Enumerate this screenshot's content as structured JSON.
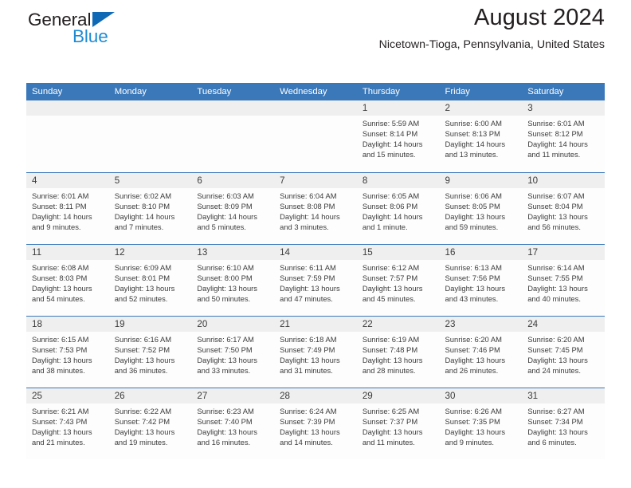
{
  "brand": {
    "name_dark": "General",
    "name_blue": "Blue",
    "triangle_color": "#1069b4",
    "blue_color": "#1e8bd4"
  },
  "header": {
    "title": "August 2024",
    "subtitle": "Nicetown-Tioga, Pennsylvania, United States",
    "header_bg": "#3a78ba",
    "header_text": "#ffffff"
  },
  "calendar": {
    "weekday_headers": [
      "Sunday",
      "Monday",
      "Tuesday",
      "Wednesday",
      "Thursday",
      "Friday",
      "Saturday"
    ],
    "weeks": [
      [
        {
          "day": "",
          "sunrise": "",
          "sunset": "",
          "daylight_line1": "",
          "daylight_line2": "",
          "empty": true
        },
        {
          "day": "",
          "sunrise": "",
          "sunset": "",
          "daylight_line1": "",
          "daylight_line2": "",
          "empty": true
        },
        {
          "day": "",
          "sunrise": "",
          "sunset": "",
          "daylight_line1": "",
          "daylight_line2": "",
          "empty": true
        },
        {
          "day": "",
          "sunrise": "",
          "sunset": "",
          "daylight_line1": "",
          "daylight_line2": "",
          "empty": true
        },
        {
          "day": "1",
          "sunrise": "Sunrise: 5:59 AM",
          "sunset": "Sunset: 8:14 PM",
          "daylight_line1": "Daylight: 14 hours",
          "daylight_line2": "and 15 minutes.",
          "empty": false
        },
        {
          "day": "2",
          "sunrise": "Sunrise: 6:00 AM",
          "sunset": "Sunset: 8:13 PM",
          "daylight_line1": "Daylight: 14 hours",
          "daylight_line2": "and 13 minutes.",
          "empty": false
        },
        {
          "day": "3",
          "sunrise": "Sunrise: 6:01 AM",
          "sunset": "Sunset: 8:12 PM",
          "daylight_line1": "Daylight: 14 hours",
          "daylight_line2": "and 11 minutes.",
          "empty": false
        }
      ],
      [
        {
          "day": "4",
          "sunrise": "Sunrise: 6:01 AM",
          "sunset": "Sunset: 8:11 PM",
          "daylight_line1": "Daylight: 14 hours",
          "daylight_line2": "and 9 minutes.",
          "empty": false
        },
        {
          "day": "5",
          "sunrise": "Sunrise: 6:02 AM",
          "sunset": "Sunset: 8:10 PM",
          "daylight_line1": "Daylight: 14 hours",
          "daylight_line2": "and 7 minutes.",
          "empty": false
        },
        {
          "day": "6",
          "sunrise": "Sunrise: 6:03 AM",
          "sunset": "Sunset: 8:09 PM",
          "daylight_line1": "Daylight: 14 hours",
          "daylight_line2": "and 5 minutes.",
          "empty": false
        },
        {
          "day": "7",
          "sunrise": "Sunrise: 6:04 AM",
          "sunset": "Sunset: 8:08 PM",
          "daylight_line1": "Daylight: 14 hours",
          "daylight_line2": "and 3 minutes.",
          "empty": false
        },
        {
          "day": "8",
          "sunrise": "Sunrise: 6:05 AM",
          "sunset": "Sunset: 8:06 PM",
          "daylight_line1": "Daylight: 14 hours",
          "daylight_line2": "and 1 minute.",
          "empty": false
        },
        {
          "day": "9",
          "sunrise": "Sunrise: 6:06 AM",
          "sunset": "Sunset: 8:05 PM",
          "daylight_line1": "Daylight: 13 hours",
          "daylight_line2": "and 59 minutes.",
          "empty": false
        },
        {
          "day": "10",
          "sunrise": "Sunrise: 6:07 AM",
          "sunset": "Sunset: 8:04 PM",
          "daylight_line1": "Daylight: 13 hours",
          "daylight_line2": "and 56 minutes.",
          "empty": false
        }
      ],
      [
        {
          "day": "11",
          "sunrise": "Sunrise: 6:08 AM",
          "sunset": "Sunset: 8:03 PM",
          "daylight_line1": "Daylight: 13 hours",
          "daylight_line2": "and 54 minutes.",
          "empty": false
        },
        {
          "day": "12",
          "sunrise": "Sunrise: 6:09 AM",
          "sunset": "Sunset: 8:01 PM",
          "daylight_line1": "Daylight: 13 hours",
          "daylight_line2": "and 52 minutes.",
          "empty": false
        },
        {
          "day": "13",
          "sunrise": "Sunrise: 6:10 AM",
          "sunset": "Sunset: 8:00 PM",
          "daylight_line1": "Daylight: 13 hours",
          "daylight_line2": "and 50 minutes.",
          "empty": false
        },
        {
          "day": "14",
          "sunrise": "Sunrise: 6:11 AM",
          "sunset": "Sunset: 7:59 PM",
          "daylight_line1": "Daylight: 13 hours",
          "daylight_line2": "and 47 minutes.",
          "empty": false
        },
        {
          "day": "15",
          "sunrise": "Sunrise: 6:12 AM",
          "sunset": "Sunset: 7:57 PM",
          "daylight_line1": "Daylight: 13 hours",
          "daylight_line2": "and 45 minutes.",
          "empty": false
        },
        {
          "day": "16",
          "sunrise": "Sunrise: 6:13 AM",
          "sunset": "Sunset: 7:56 PM",
          "daylight_line1": "Daylight: 13 hours",
          "daylight_line2": "and 43 minutes.",
          "empty": false
        },
        {
          "day": "17",
          "sunrise": "Sunrise: 6:14 AM",
          "sunset": "Sunset: 7:55 PM",
          "daylight_line1": "Daylight: 13 hours",
          "daylight_line2": "and 40 minutes.",
          "empty": false
        }
      ],
      [
        {
          "day": "18",
          "sunrise": "Sunrise: 6:15 AM",
          "sunset": "Sunset: 7:53 PM",
          "daylight_line1": "Daylight: 13 hours",
          "daylight_line2": "and 38 minutes.",
          "empty": false
        },
        {
          "day": "19",
          "sunrise": "Sunrise: 6:16 AM",
          "sunset": "Sunset: 7:52 PM",
          "daylight_line1": "Daylight: 13 hours",
          "daylight_line2": "and 36 minutes.",
          "empty": false
        },
        {
          "day": "20",
          "sunrise": "Sunrise: 6:17 AM",
          "sunset": "Sunset: 7:50 PM",
          "daylight_line1": "Daylight: 13 hours",
          "daylight_line2": "and 33 minutes.",
          "empty": false
        },
        {
          "day": "21",
          "sunrise": "Sunrise: 6:18 AM",
          "sunset": "Sunset: 7:49 PM",
          "daylight_line1": "Daylight: 13 hours",
          "daylight_line2": "and 31 minutes.",
          "empty": false
        },
        {
          "day": "22",
          "sunrise": "Sunrise: 6:19 AM",
          "sunset": "Sunset: 7:48 PM",
          "daylight_line1": "Daylight: 13 hours",
          "daylight_line2": "and 28 minutes.",
          "empty": false
        },
        {
          "day": "23",
          "sunrise": "Sunrise: 6:20 AM",
          "sunset": "Sunset: 7:46 PM",
          "daylight_line1": "Daylight: 13 hours",
          "daylight_line2": "and 26 minutes.",
          "empty": false
        },
        {
          "day": "24",
          "sunrise": "Sunrise: 6:20 AM",
          "sunset": "Sunset: 7:45 PM",
          "daylight_line1": "Daylight: 13 hours",
          "daylight_line2": "and 24 minutes.",
          "empty": false
        }
      ],
      [
        {
          "day": "25",
          "sunrise": "Sunrise: 6:21 AM",
          "sunset": "Sunset: 7:43 PM",
          "daylight_line1": "Daylight: 13 hours",
          "daylight_line2": "and 21 minutes.",
          "empty": false
        },
        {
          "day": "26",
          "sunrise": "Sunrise: 6:22 AM",
          "sunset": "Sunset: 7:42 PM",
          "daylight_line1": "Daylight: 13 hours",
          "daylight_line2": "and 19 minutes.",
          "empty": false
        },
        {
          "day": "27",
          "sunrise": "Sunrise: 6:23 AM",
          "sunset": "Sunset: 7:40 PM",
          "daylight_line1": "Daylight: 13 hours",
          "daylight_line2": "and 16 minutes.",
          "empty": false
        },
        {
          "day": "28",
          "sunrise": "Sunrise: 6:24 AM",
          "sunset": "Sunset: 7:39 PM",
          "daylight_line1": "Daylight: 13 hours",
          "daylight_line2": "and 14 minutes.",
          "empty": false
        },
        {
          "day": "29",
          "sunrise": "Sunrise: 6:25 AM",
          "sunset": "Sunset: 7:37 PM",
          "daylight_line1": "Daylight: 13 hours",
          "daylight_line2": "and 11 minutes.",
          "empty": false
        },
        {
          "day": "30",
          "sunrise": "Sunrise: 6:26 AM",
          "sunset": "Sunset: 7:35 PM",
          "daylight_line1": "Daylight: 13 hours",
          "daylight_line2": "and 9 minutes.",
          "empty": false
        },
        {
          "day": "31",
          "sunrise": "Sunrise: 6:27 AM",
          "sunset": "Sunset: 7:34 PM",
          "daylight_line1": "Daylight: 13 hours",
          "daylight_line2": "and 6 minutes.",
          "empty": false
        }
      ]
    ]
  }
}
